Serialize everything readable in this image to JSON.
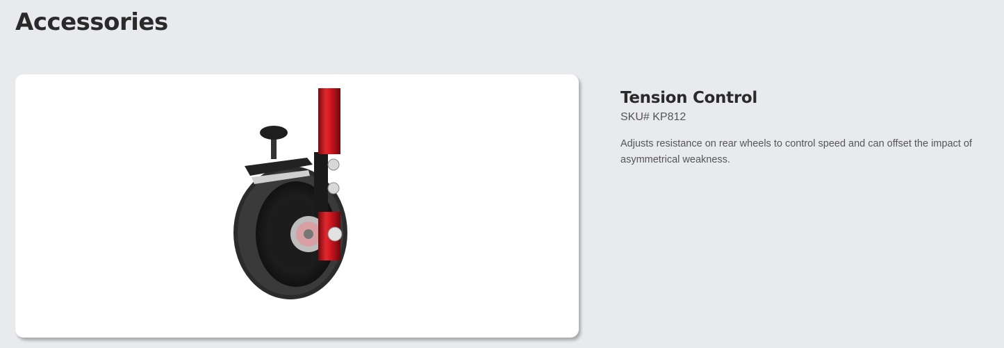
{
  "page": {
    "title": "Accessories"
  },
  "product": {
    "name": "Tension Control",
    "sku": "SKU# KP812",
    "description": "Adjusts resistance on rear wheels to control speed and can offset the impact of asymmetrical weakness.",
    "image_icon": "wheel-tension-control-image"
  },
  "colors": {
    "background": "#e9eaee",
    "card": "#ffffff",
    "frame_red": "#c8141c",
    "tire": "#2b2b2b"
  }
}
